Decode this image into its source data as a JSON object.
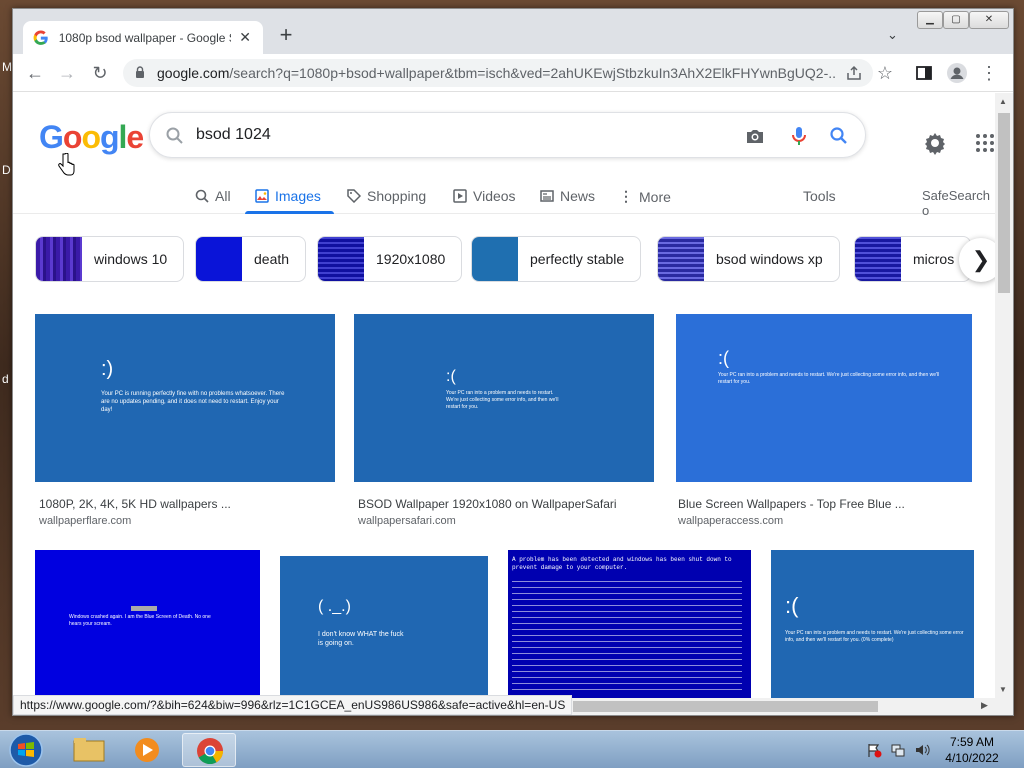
{
  "desktop": {
    "fragments": [
      "M",
      "D",
      "d"
    ]
  },
  "browser": {
    "tab_title": "1080p bsod wallpaper - Google S",
    "url_host": "google.com",
    "url_rest": "/search?q=1080p+bsod+wallpaper&tbm=isch&ved=2ahUKEwjStbzkuIn3AhX2ElkFHYwnBgUQ2-..."
  },
  "google": {
    "logo_letters": [
      "G",
      "o",
      "o",
      "g",
      "l",
      "e"
    ],
    "logo_colors": [
      "#4285f4",
      "#ea4335",
      "#fbbc05",
      "#4285f4",
      "#34a853",
      "#ea4335"
    ],
    "query": "bsod 1024",
    "nav": [
      {
        "label": "All",
        "icon": "search-icon"
      },
      {
        "label": "Images",
        "icon": "image-icon",
        "active": true
      },
      {
        "label": "Shopping",
        "icon": "tag-icon"
      },
      {
        "label": "Videos",
        "icon": "play-icon"
      },
      {
        "label": "News",
        "icon": "news-icon"
      },
      {
        "label": "More",
        "icon": "more-icon"
      }
    ],
    "tools": "Tools",
    "safesearch": "SafeSearch o",
    "chips": [
      "windows 10",
      "death",
      "1920x1080",
      "perfectly stable",
      "bsod windows xp",
      "micros"
    ],
    "results": [
      {
        "title": "1080P, 2K, 4K, 5K HD wallpapers ...",
        "source": "wallpaperflare.com",
        "face": ":)",
        "text": "Your PC is running perfectly fine with no problems whatsoever. There are no updates pending, and it does not need to restart. Enjoy your day!"
      },
      {
        "title": "BSOD Wallpaper 1920x1080 on WallpaperSafari",
        "source": "wallpapersafari.com",
        "face": ":(",
        "text": "Your PC ran into a problem and needs to restart. We're just collecting some error info, and then we'll restart for you."
      },
      {
        "title": "Blue Screen Wallpapers - Top Free Blue ...",
        "source": "wallpaperaccess.com",
        "face": ":(",
        "text": "Your PC ran into a problem and needs to restart. We're just collecting some error info, and then we'll restart for you."
      }
    ],
    "row2": [
      {
        "face": "",
        "text": "Windows crashed again. I am the Blue Screen of Death. No one hears your scream."
      },
      {
        "face": "( ._.)",
        "text": "I don't know WHAT the fuck is going on."
      },
      {
        "face": "",
        "text": "A problem has been detected and windows has been shut down to prevent damage to your computer."
      },
      {
        "face": ":(",
        "text": "Your PC ran into a problem and needs to restart. We're just collecting some error info, and then we'll restart for you. (0% complete)"
      }
    ]
  },
  "status_url": "https://www.google.com/?&bih=624&biw=996&rlz=1C1GCEA_enUS986US986&safe=active&hl=en-US",
  "taskbar": {
    "time": "7:59 AM",
    "date": "4/10/2022"
  },
  "colors": {
    "bsod_blue": "#2067b2",
    "bsod_royal": "#0000e0",
    "accent": "#1a73e8"
  }
}
